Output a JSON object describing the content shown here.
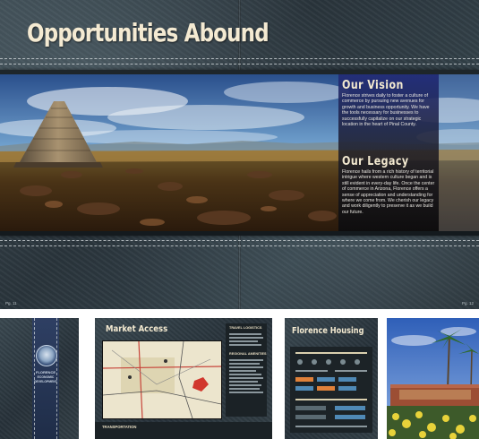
{
  "spread": {
    "headline": "Opportunities Abound",
    "vision_title": "Our Vision",
    "vision_text": "Florence strives daily to foster a culture of commerce by pursuing new avenues for growth and business opportunity. We have the tools necessary for businesses to successfully capitalize on our strategic location in the heart of Pinal County.",
    "legacy_title": "Our Legacy",
    "legacy_text": "Florence hails from a rich history of territorial intrigue where western culture began and is still evident in every-day life. Once the center of commerce in Arizona, Florence offers a sense of appreciation and understanding for where we come from. We cherish our legacy and work diligently to preserve it as we build our future.",
    "page_left": "Pg. 11",
    "page_right": "Pg. 12"
  },
  "thumbnails": {
    "cover_line1": "FLORENCE",
    "cover_line2": "ECONOMIC",
    "cover_line3": "DEVELOPMENT",
    "market_title": "Market Access",
    "market_side1": "TRAVEL LOGISTICS",
    "market_side2": "REGIONAL AMENITIES",
    "market_bottom": "TRANSPORTATION",
    "housing_title": "Florence Housing"
  },
  "colors": {
    "leather": "#2f3b42",
    "vision_blue": "#22307a",
    "headline_cream": "#f4ead2",
    "sky_blue": "#3f6cc0"
  }
}
